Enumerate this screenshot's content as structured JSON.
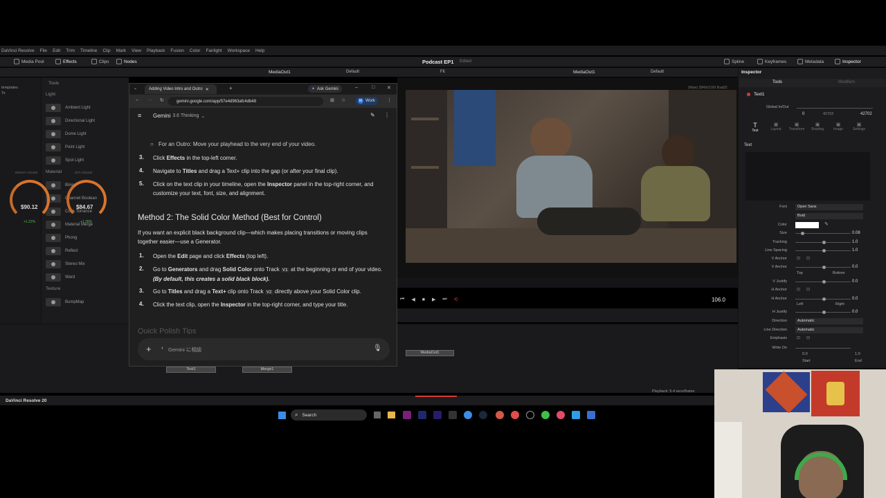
{
  "app": {
    "name": "DaVinci Resolve",
    "menu": [
      "File",
      "Edit",
      "Trim",
      "Timeline",
      "Clip",
      "Mark",
      "View",
      "Playback",
      "Fusion",
      "Color",
      "Fairlight",
      "Workspace",
      "Help"
    ],
    "project_title": "Podcast EP1",
    "project_status": "Edited",
    "footer_name": "DaVinci Resolve 20",
    "playback_status": "Playback: 5.4 secs/frame"
  },
  "toolbar": {
    "media_pool": "Media Pool",
    "effects": "Effects",
    "clips": "Clips",
    "nodes": "Nodes",
    "spline": "Spline",
    "keyframes": "Keyframes",
    "metadata": "Metadata",
    "inspector": "Inspector"
  },
  "viewerbar": {
    "left_viewer": "MediaOut1",
    "left_zoom": "Fit",
    "left_mode": "Default",
    "right_viewer": "MediaOut1",
    "right_zoom": "Fit",
    "right_mode": "Default",
    "inspector_title": "Inspector"
  },
  "library": {
    "categories": [
      "templates",
      "Ts"
    ],
    "tools_header": "Tools",
    "light_header": "Light",
    "light_items": [
      "Ambient Light",
      "Directional Light",
      "Dome Light",
      "Point Light",
      "Spot Light"
    ],
    "material_header": "Material",
    "material_items": [
      "Blinn",
      "Channel Boolean",
      "Cook Torrance",
      "Material Merge",
      "Phong",
      "Reflect",
      "Stereo Mix",
      "Ward"
    ],
    "texture_header": "Texture",
    "texture_items": [
      "BumpMap"
    ]
  },
  "gauges": [
    {
      "value": "$90.12",
      "change": "+1.22%",
      "label": "BRENT CRUDE"
    },
    {
      "value": "$84.67",
      "change": "+1.28%",
      "label": "WTI CRUDE"
    }
  ],
  "browser": {
    "tab_title": "Adding Video Intro and Outro",
    "ask_button": "Ask Gemini",
    "url": "gemini.google.com/app/57e4d963afc4db48",
    "profile_label": "Work",
    "profile_initial": "M",
    "gemini_name": "Gemini",
    "gemini_model": "3.6 Thinking",
    "bullet_outro_lead": "For an Outro:",
    "bullet_outro_text": "Move your playhead to the very end of your video.",
    "steps_a": [
      {
        "num": "3.",
        "lead": "Click ",
        "bold": "Effects",
        "rest": " in the top-left corner."
      },
      {
        "num": "4.",
        "lead": "Navigate to ",
        "bold": "Titles",
        "rest": " and drag a Text+ clip into the gap (or after your final clip)."
      },
      {
        "num": "5.",
        "lead": "Click on the text clip in your timeline, open the ",
        "bold": "Inspector",
        "rest": " panel in the top-right corner, and customize your text, font, size, and alignment."
      }
    ],
    "method2_title": "Method 2: The Solid Color Method (Best for Control)",
    "method2_intro": "If you want an explicit black background clip—which makes placing transitions or moving clips together easier—use a Generator.",
    "steps_b": [
      {
        "num": "1.",
        "lead": "Open the ",
        "bold": "Edit",
        "mid": " page and click ",
        "bold2": "Effects",
        "rest": " (top left)."
      },
      {
        "num": "2.",
        "lead": "Go to ",
        "bold": "Generators",
        "mid": " and drag ",
        "bold2": "Solid Color",
        "rest": " onto Track ",
        "code": "V1",
        "rest2": " at the beginning or end of your video. ",
        "italic": "(By default, this creates a solid black block)."
      },
      {
        "num": "3.",
        "lead": "Go to ",
        "bold": "Titles",
        "mid": " and drag a ",
        "bold2": "Text+",
        "rest": " clip onto Track ",
        "code": "V2",
        "rest2": " directly above your Solid Color clip."
      },
      {
        "num": "4.",
        "lead": "Click the text clip, open the ",
        "bold": "Inspector",
        "rest": " in the top-right corner, and type your title."
      }
    ],
    "fading_heading": "Quick Polish Tips",
    "prompt_placeholder": "Gemini に相談"
  },
  "viewer": {
    "timecode": "106.0",
    "resolution": "(Main) 3840x2160 float32"
  },
  "nodes": {
    "media_out": "MediaOut1",
    "text_node": "Text1",
    "merge_node": "Merge1"
  },
  "inspector": {
    "tabs_top": [
      "Tools",
      "Modifiers"
    ],
    "node_name": "Text1",
    "global_inout_label": "Global In/Out",
    "global_in": "0",
    "global_mid": "42702",
    "global_out": "42702",
    "subtabs": [
      "Text",
      "Layout",
      "Transform",
      "Shading",
      "Image",
      "Settings"
    ],
    "section": "Text",
    "rows": [
      {
        "label": "Font",
        "value": "Open Sans",
        "type": "drop"
      },
      {
        "label": "",
        "value": "Bold",
        "type": "drop"
      },
      {
        "label": "Color",
        "value": "",
        "type": "color"
      },
      {
        "label": "Size",
        "value": "0.08",
        "type": "slider",
        "pos": 0.1
      },
      {
        "label": "Tracking",
        "value": "1.0",
        "type": "slider",
        "pos": 0.5
      },
      {
        "label": "Line Spacing",
        "value": "1.0",
        "type": "slider",
        "pos": 0.5
      },
      {
        "label": "V Anchor",
        "value": "",
        "type": "icons"
      },
      {
        "label": "V Anchor",
        "value": "0.0",
        "type": "slider",
        "pos": 0.5
      },
      {
        "label": "V Justify",
        "value": "0.0",
        "type": "slider",
        "pos": 0.5
      },
      {
        "label": "H Anchor",
        "value": "",
        "type": "icons"
      },
      {
        "label": "H Anchor",
        "value": "0.0",
        "type": "slider",
        "pos": 0.5
      },
      {
        "label": "H Justify",
        "value": "0.0",
        "type": "slider",
        "pos": 0.5
      },
      {
        "label": "Direction",
        "value": "Automatic",
        "type": "drop"
      },
      {
        "label": "Line Direction",
        "value": "Automatic",
        "type": "drop"
      },
      {
        "label": "Emphasis",
        "value": "",
        "type": "icons"
      },
      {
        "label": "Write On",
        "value": "",
        "type": "range"
      }
    ],
    "vanchor_top": "Top",
    "vanchor_bottom": "Bottom",
    "hanchor_left": "Left",
    "hanchor_right": "Right",
    "writeon_start": "0.0",
    "writeon_end": "1.0",
    "writeon_start_label": "Start",
    "writeon_end_label": "End"
  },
  "taskbar": {
    "search": "Search"
  },
  "colors": {
    "accent_orange": "#d9742b",
    "inspector_active": "#e8e8e8",
    "record_red": "#d83b3b"
  }
}
